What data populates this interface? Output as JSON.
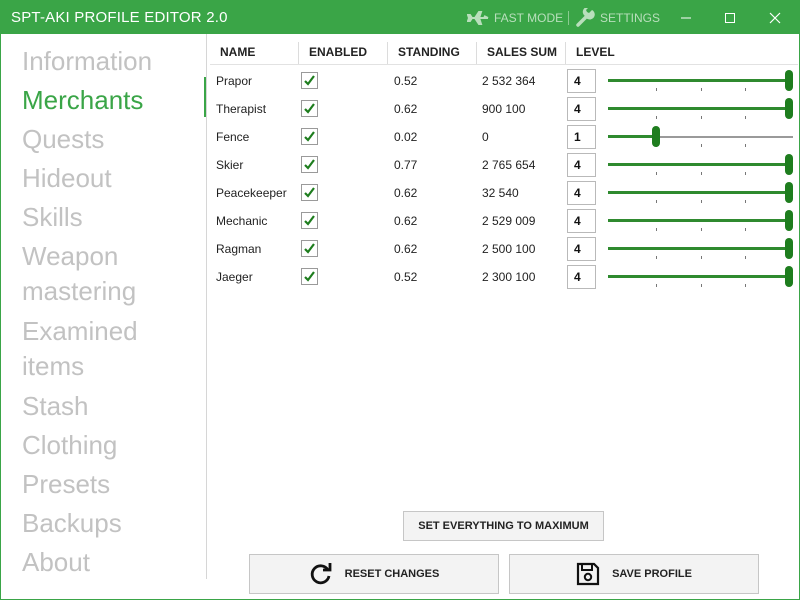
{
  "app": {
    "title": "SPT-AKI PROFILE EDITOR  2.0"
  },
  "titlebar": {
    "fast_mode": "FAST MODE",
    "settings": "SETTINGS"
  },
  "nav": [
    {
      "label": "Information",
      "active": false
    },
    {
      "label": "Merchants",
      "active": true
    },
    {
      "label": "Quests",
      "active": false
    },
    {
      "label": "Hideout",
      "active": false
    },
    {
      "label": "Skills",
      "active": false
    },
    {
      "label": "Weapon",
      "label2": "mastering",
      "active": false
    },
    {
      "label": "Examined",
      "label2": "items",
      "active": false
    },
    {
      "label": "Stash",
      "active": false
    },
    {
      "label": "Clothing",
      "active": false
    },
    {
      "label": "Presets",
      "active": false
    },
    {
      "label": "Backups",
      "active": false
    },
    {
      "label": "About",
      "active": false
    }
  ],
  "table": {
    "headers": {
      "name": "NAME",
      "enabled": "ENABLED",
      "standing": "STANDING",
      "sales_sum": "SALES SUM",
      "level": "LEVEL"
    },
    "level_max": 4,
    "rows": [
      {
        "name": "Prapor",
        "enabled": true,
        "standing": "0.52",
        "sales_sum": "2 532 364",
        "level": "4"
      },
      {
        "name": "Therapist",
        "enabled": true,
        "standing": "0.62",
        "sales_sum": "900 100",
        "level": "4"
      },
      {
        "name": "Fence",
        "enabled": true,
        "standing": "0.02",
        "sales_sum": "0",
        "level": "1"
      },
      {
        "name": "Skier",
        "enabled": true,
        "standing": "0.77",
        "sales_sum": "2 765 654",
        "level": "4"
      },
      {
        "name": "Peacekeeper",
        "enabled": true,
        "standing": "0.62",
        "sales_sum": "32 540",
        "level": "4"
      },
      {
        "name": "Mechanic",
        "enabled": true,
        "standing": "0.62",
        "sales_sum": "2 529 009",
        "level": "4"
      },
      {
        "name": "Ragman",
        "enabled": true,
        "standing": "0.62",
        "sales_sum": "2 500 100",
        "level": "4"
      },
      {
        "name": "Jaeger",
        "enabled": true,
        "standing": "0.52",
        "sales_sum": "2 300 100",
        "level": "4"
      }
    ]
  },
  "buttons": {
    "set_max": "SET EVERYTHING TO MAXIMUM",
    "reset": "RESET CHANGES",
    "save": "SAVE PROFILE"
  },
  "colors": {
    "accent": "#3aa547",
    "slider": "#1e7d1e",
    "inactive_nav": "#c2c2c2"
  }
}
